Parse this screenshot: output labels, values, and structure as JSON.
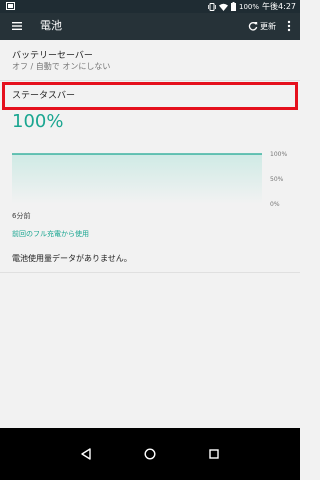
{
  "status_bar": {
    "battery_pct": "100%",
    "time": "午後4:27"
  },
  "app_bar": {
    "title": "電池",
    "refresh_label": "更新",
    "icons": [
      "menu-icon",
      "refresh-icon",
      "more-vert-icon"
    ]
  },
  "battery_saver": {
    "title": "バッテリーセーバー",
    "subtitle": "オフ / 自動で オンにしない"
  },
  "status_bar_setting": {
    "label": "ステータスバー"
  },
  "battery": {
    "level_text": "100%",
    "level": 100,
    "accent_color": "#1aa691"
  },
  "graph": {
    "axis_labels": [
      "100%",
      "50%",
      "0%"
    ],
    "time_label": "6分前"
  },
  "usage": {
    "since_link": "前回のフル充電から使用",
    "empty_message": "電池使用量データがありません。"
  },
  "highlight_color": "#e5101d"
}
